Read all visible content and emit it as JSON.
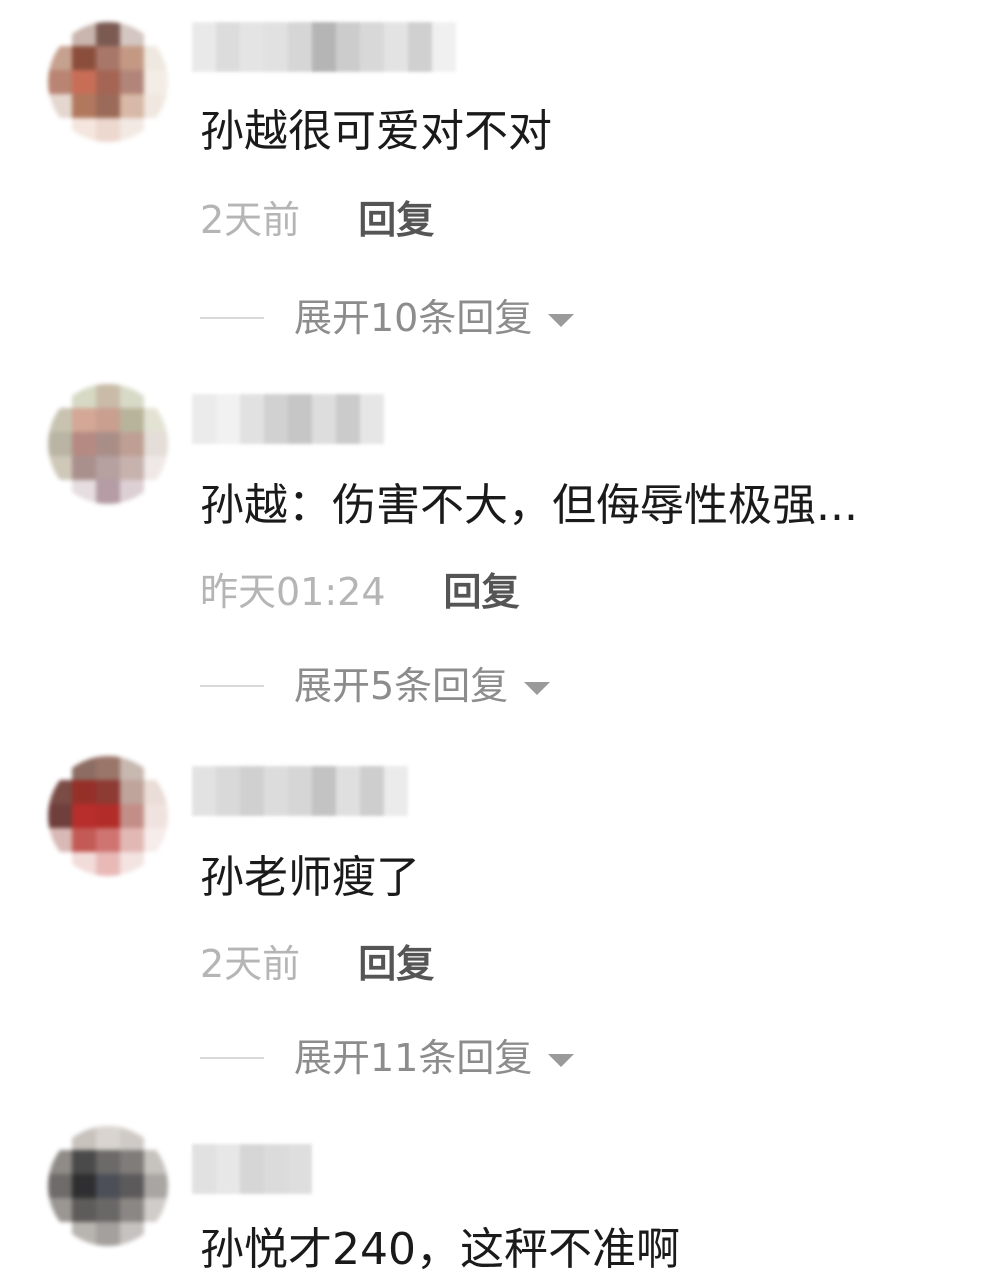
{
  "comments": [
    {
      "text": "孙越很可爱对不对",
      "time": "2天前",
      "reply_label": "回复",
      "expand_label": "展开10条回复",
      "avatar_colors": [
        "#ffffff",
        "#c9b5ad",
        "#7b5a52",
        "#d4c6c0",
        "#ffffff",
        "#c7a18f",
        "#8b4e3c",
        "#a9776a",
        "#c49984",
        "#efe8e0",
        "#b98472",
        "#c86e57",
        "#a56554",
        "#b2857a",
        "#f3ede6",
        "#e4d7d0",
        "#b1785e",
        "#9b6a58",
        "#d8b8a6",
        "#f0e8e0",
        "#ffffff",
        "#f4e6de",
        "#ecd8ce",
        "#f2e9e3",
        "#ffffff"
      ],
      "name_colors": [
        "#e6e6e6",
        "#d7d7d7",
        "#e0e0e0",
        "#dcdcdc",
        "#cfcfcf",
        "#a9a9a9",
        "#c4c4c4",
        "#d2d2d2",
        "#dfdfdf",
        "#c8c8c8",
        "#eeeeee"
      ]
    },
    {
      "text": "孙越：伤害不大，但侮辱性极强...",
      "time": "昨天01:24",
      "reply_label": "回复",
      "expand_label": "展开5条回复",
      "avatar_colors": [
        "#ffffff",
        "#d6d9c4",
        "#c9bba8",
        "#d8dac8",
        "#ffffff",
        "#c7c3b0",
        "#d4a796",
        "#c99f90",
        "#b8b49b",
        "#e3e3d4",
        "#b9b4a3",
        "#b58a82",
        "#a98e88",
        "#bf9f94",
        "#e4ddd8",
        "#cfc8b9",
        "#a9908d",
        "#b6a0a0",
        "#c7b2ae",
        "#efe8e6",
        "#ffffff",
        "#e6dde0",
        "#b59ca5",
        "#ddd0d4",
        "#ffffff"
      ],
      "name_colors": [
        "#e8e8e8",
        "#efefef",
        "#dcdcdc",
        "#c9c9c9",
        "#bdbdbd",
        "#d8d8d8",
        "#c2c2c2",
        "#e2e2e2"
      ]
    },
    {
      "text": "孙老师瘦了",
      "time": "2天前",
      "reply_label": "回复",
      "expand_label": "展开11条回复",
      "avatar_colors": [
        "#ffffff",
        "#8c6d63",
        "#9a7569",
        "#c7b8b0",
        "#ffffff",
        "#7a4c46",
        "#953029",
        "#8d3b33",
        "#bfa49c",
        "#eadcd6",
        "#6f3f3c",
        "#b72e2c",
        "#b22d29",
        "#c48e88",
        "#f0e2df",
        "#d8b9b5",
        "#c45a55",
        "#cf7470",
        "#e2b8b4",
        "#f6ecea",
        "#ffffff",
        "#f2dcda",
        "#e8b9b7",
        "#f3e3e1",
        "#ffffff"
      ],
      "name_colors": [
        "#dedede",
        "#d3d3d3",
        "#c8c8c8",
        "#d7d7d7",
        "#cfcfcf",
        "#b9b9b9",
        "#dadada",
        "#c6c6c6",
        "#e8e8e8"
      ]
    },
    {
      "text": "孙悦才240，这秤不准啊",
      "avatar_colors": [
        "#ffffff",
        "#c8c2bd",
        "#d9d4cf",
        "#cfcac6",
        "#ffffff",
        "#8f8b87",
        "#4a4a4a",
        "#6c6a68",
        "#7f7c7a",
        "#c6c2be",
        "#6e6b69",
        "#2f2f31",
        "#4c4f58",
        "#5c5a5a",
        "#a9a5a2",
        "#9a9692",
        "#5e5c5a",
        "#6a6866",
        "#8b8784",
        "#d0ccc9",
        "#ffffff",
        "#b8b4b0",
        "#a3a09d",
        "#c6c2bf",
        "#ffffff"
      ],
      "name_colors": [
        "#dcdcdc",
        "#e3e3e3",
        "#cfcfcf",
        "#d5d5d5",
        "#d9d9d9"
      ]
    }
  ]
}
